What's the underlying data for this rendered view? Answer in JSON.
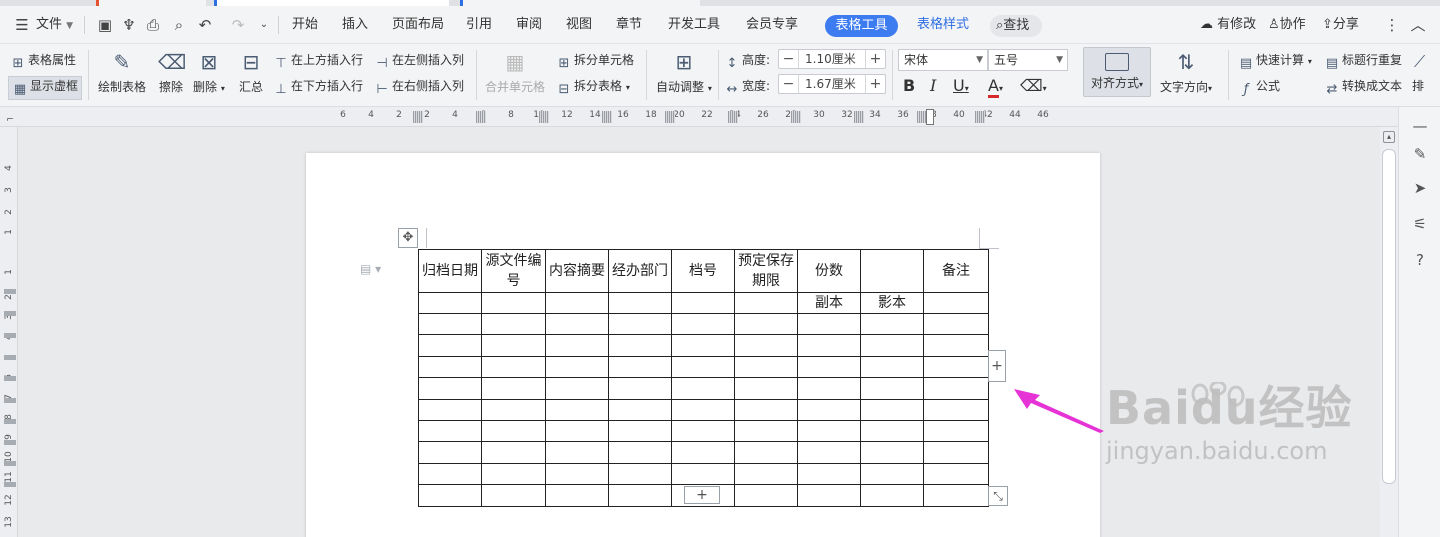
{
  "menubar": {
    "file_label": "文件",
    "tabs": [
      "开始",
      "插入",
      "页面布局",
      "引用",
      "审阅",
      "视图",
      "章节",
      "开发工具",
      "会员专享"
    ],
    "active_tab": "表格工具",
    "style_tab": "表格样式",
    "search_label": "查找",
    "has_changes_label": "有修改",
    "collab_label": "协作",
    "share_label": "分享"
  },
  "ribbon": {
    "table_props": "表格属性",
    "show_grid": "显示虚框",
    "draw_table": "绘制表格",
    "erase": "擦除",
    "delete": "删除",
    "summary": "汇总",
    "insert_above": "在上方插入行",
    "insert_below": "在下方插入行",
    "insert_left": "在左侧插入列",
    "insert_right": "在右侧插入列",
    "merge_cells": "合并单元格",
    "split_cells": "拆分单元格",
    "split_table": "拆分表格",
    "auto_adjust": "自动调整",
    "height_label": "高度:",
    "height_value": "1.10厘米",
    "width_label": "宽度:",
    "width_value": "1.67厘米",
    "font_name": "宋体",
    "font_size": "五号",
    "align_label": "对齐方式",
    "text_dir_label": "文字方向",
    "quick_calc": "快速计算",
    "repeat_header": "标题行重复",
    "formula": "公式",
    "to_text": "转换成文本",
    "sort_partial": "排"
  },
  "ruler_h": [
    "6",
    "4",
    "2",
    "2",
    "4",
    "6",
    "8",
    "10",
    "12",
    "14",
    "16",
    "18",
    "20",
    "22",
    "24",
    "26",
    "28",
    "30",
    "32",
    "34",
    "36",
    "38",
    "40",
    "42",
    "44",
    "46"
  ],
  "ruler_v": [
    "4",
    "3",
    "2",
    "1",
    "1",
    "2",
    "3",
    "4",
    "5",
    "6",
    "7",
    "8",
    "9",
    "10",
    "11",
    "12",
    "13"
  ],
  "table": {
    "headers": [
      "归档日期",
      "源文件编号",
      "内容摘要",
      "经办部门",
      "档号",
      "预定保存期限",
      "份数",
      "",
      "备注"
    ],
    "subheaders": [
      "",
      "",
      "",
      "",
      "",
      "",
      "副本",
      "影本",
      ""
    ],
    "empty_rows": 9
  },
  "watermark": {
    "main": "Baidu经验",
    "sub": "jingyan.baidu.com"
  },
  "colors": {
    "accent": "#3d7bf0",
    "arrow": "#e633d6",
    "tab_red": "#e8512f"
  }
}
